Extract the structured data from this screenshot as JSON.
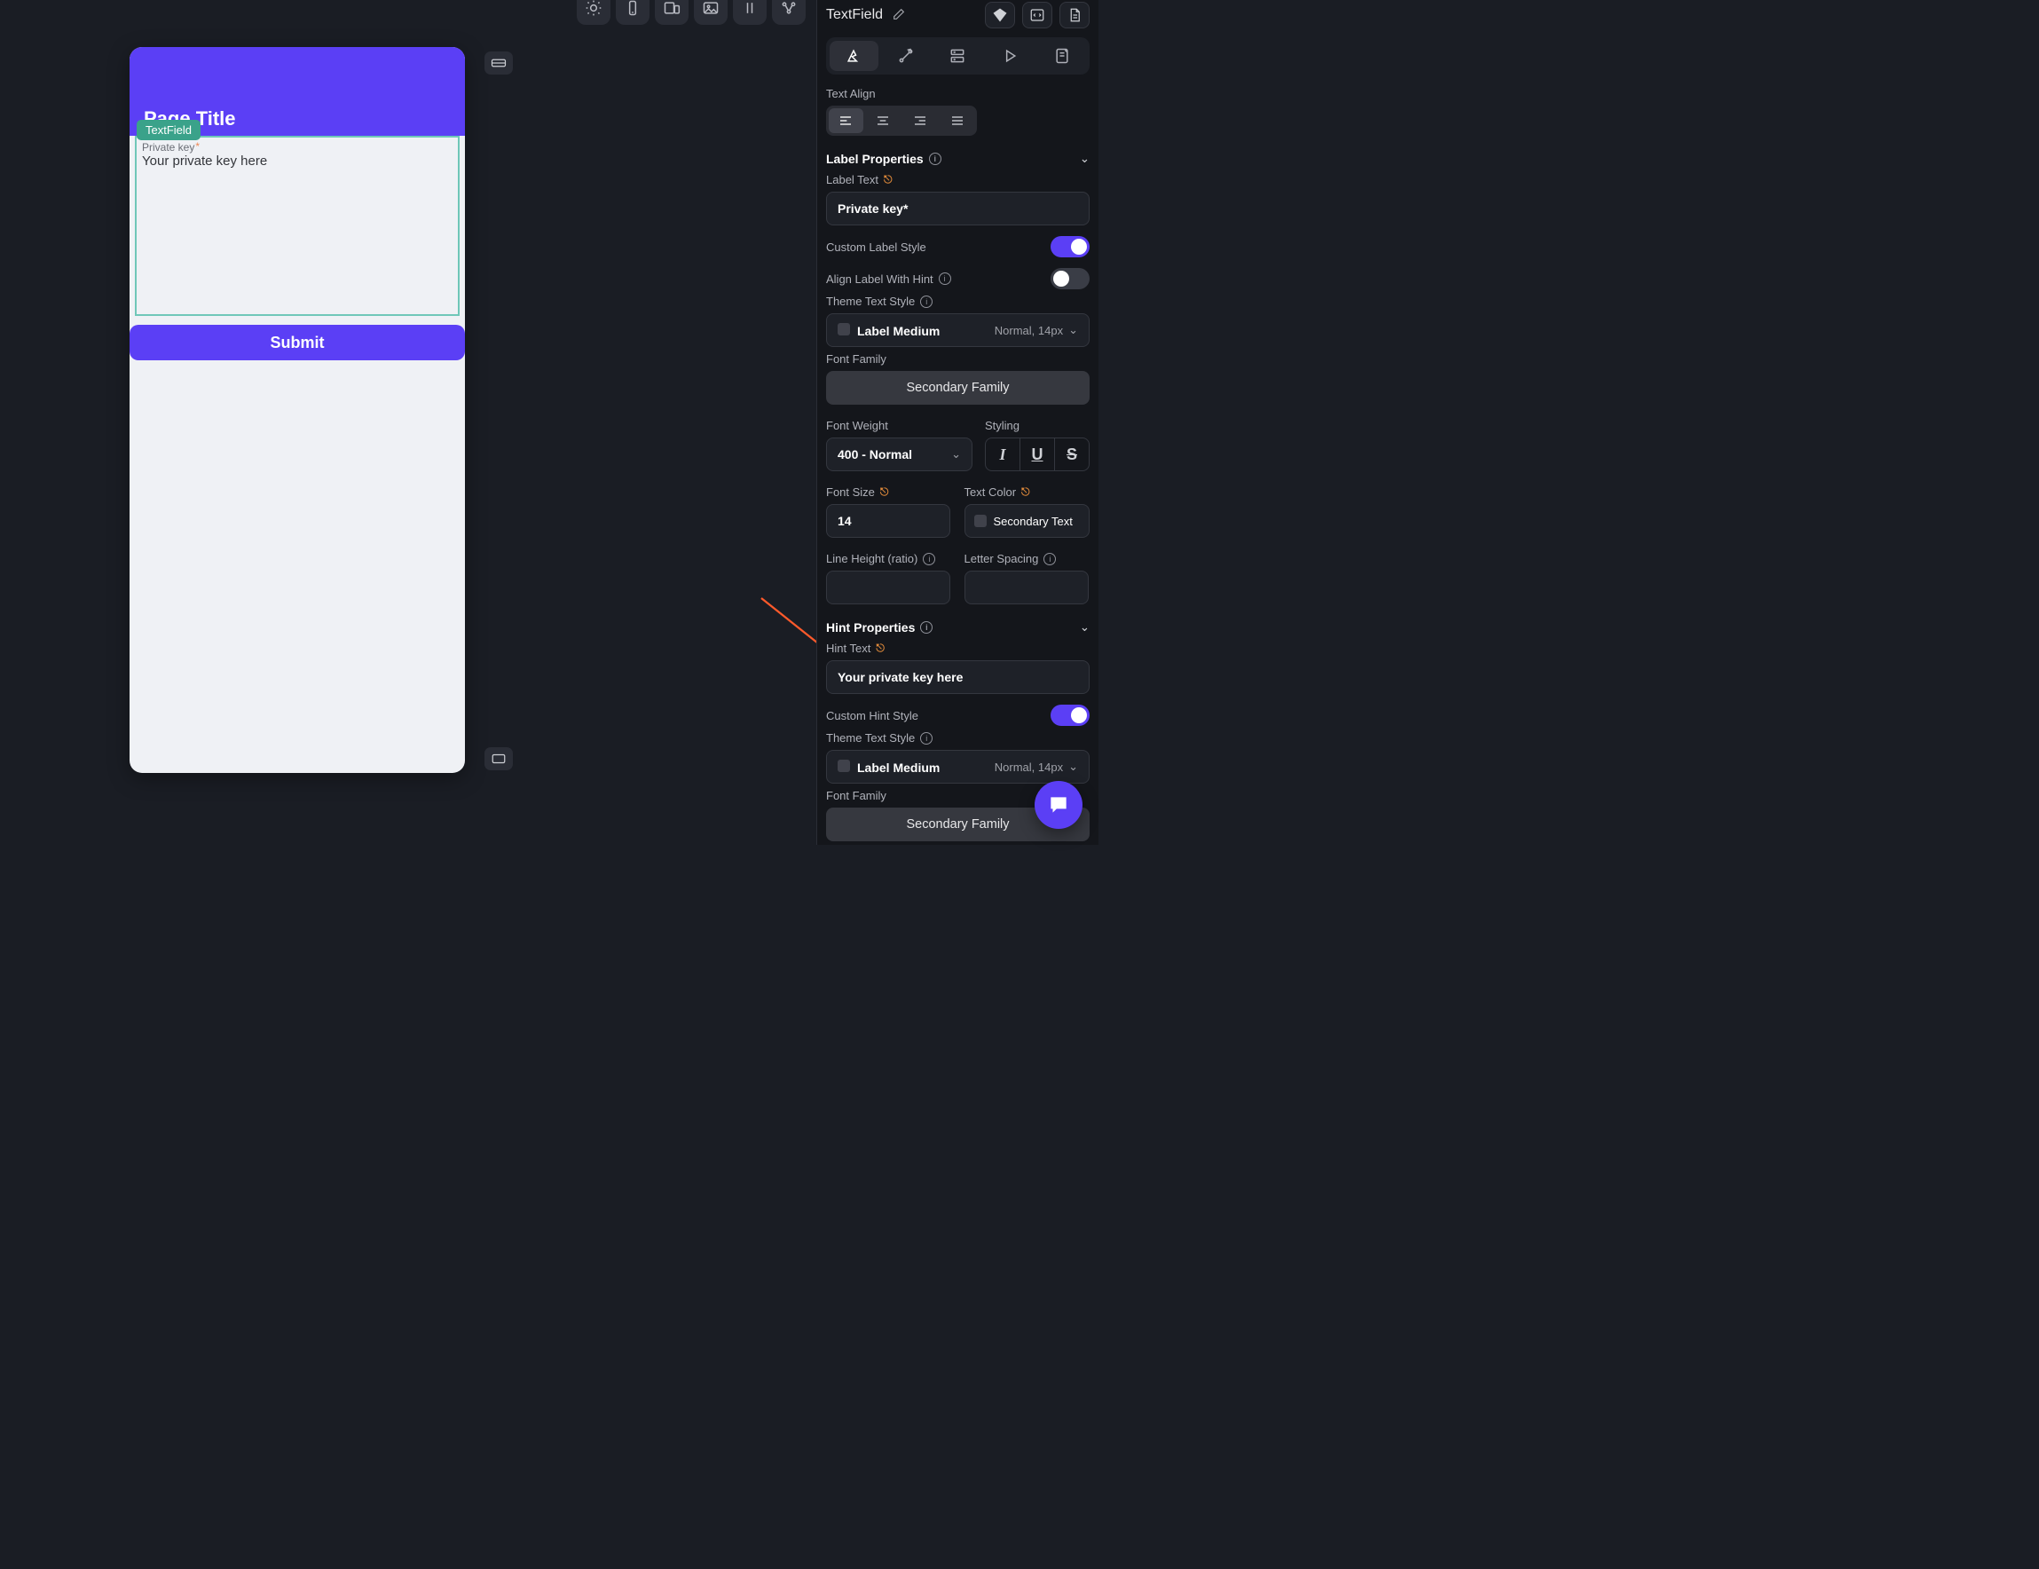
{
  "toolbar": {
    "icons": [
      "sun-icon",
      "phone-icon",
      "copy-icon",
      "image-icon",
      "pause-icon",
      "settings-icon"
    ]
  },
  "canvas": {
    "page_title": "Page Title",
    "widget_badge": "TextField",
    "field_label": "Private key",
    "field_hint": "Your private key here",
    "submit_label": "Submit"
  },
  "panel": {
    "title": "TextField",
    "tabs": [
      "design",
      "actions",
      "data",
      "play",
      "doc"
    ],
    "text_align_label": "Text Align",
    "label_props": {
      "section_title": "Label Properties",
      "label_text_label": "Label Text",
      "label_text_value": "Private key*",
      "custom_style_label": "Custom Label Style",
      "custom_style_on": true,
      "align_with_hint_label": "Align Label With Hint",
      "align_with_hint_on": false,
      "theme_style_label": "Theme Text Style",
      "theme_style_value": "Label Medium",
      "theme_style_meta": "Normal, 14px",
      "font_family_label": "Font Family",
      "font_family_value": "Secondary Family",
      "font_weight_label": "Font Weight",
      "font_weight_value": "400 - Normal",
      "styling_label": "Styling",
      "font_size_label": "Font Size",
      "font_size_value": "14",
      "text_color_label": "Text Color",
      "text_color_value": "Secondary Text",
      "line_height_label": "Line Height (ratio)",
      "letter_spacing_label": "Letter Spacing"
    },
    "hint_props": {
      "section_title": "Hint Properties",
      "hint_text_label": "Hint Text",
      "hint_text_value": "Your private key here",
      "custom_style_label": "Custom Hint Style",
      "custom_style_on": true,
      "theme_style_label": "Theme Text Style",
      "theme_style_value": "Label Medium",
      "theme_style_meta": "Normal, 14px",
      "font_family_label": "Font Family",
      "font_family_value": "Secondary Family"
    }
  }
}
